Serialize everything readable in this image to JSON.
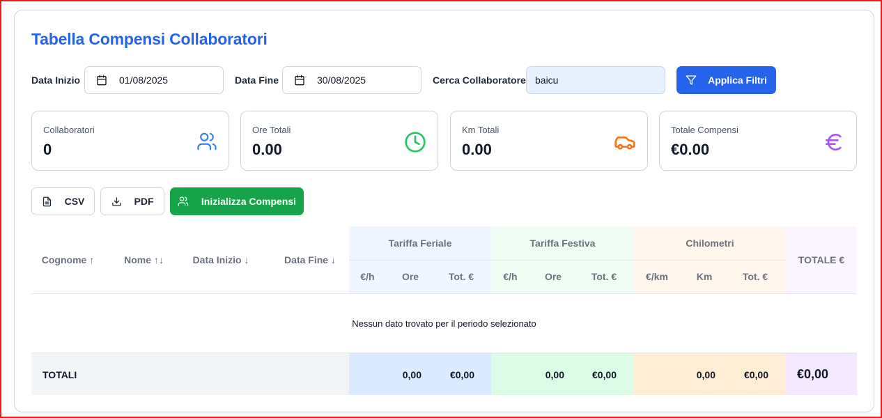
{
  "title": "Tabella Compensi Collaboratori",
  "filters": {
    "start_label": "Data Inizio",
    "start_value": "01/08/2025",
    "end_label": "Data Fine",
    "end_value": "30/08/2025",
    "search_label": "Cerca Collaboratore",
    "search_value": "baicu",
    "apply_label": "Applica Filtri"
  },
  "stats": [
    {
      "label": "Collaboratori",
      "value": "0",
      "icon": "users-icon",
      "color": "#3b82f6"
    },
    {
      "label": "Ore Totali",
      "value": "0.00",
      "icon": "clock-icon",
      "color": "#22c55e"
    },
    {
      "label": "Km Totali",
      "value": "0.00",
      "icon": "car-icon",
      "color": "#f97316"
    },
    {
      "label": "Totale Compensi",
      "value": "€0.00",
      "icon": "euro-icon",
      "color": "#a855f7"
    }
  ],
  "actions": {
    "csv": "CSV",
    "pdf": "PDF",
    "init": "Inizializza Compensi"
  },
  "table": {
    "columns": {
      "cognome": "Cognome ↑",
      "nome": "Nome ↑↓",
      "data_inizio": "Data Inizio ↓",
      "data_fine": "Data Fine ↓",
      "totale": "TOTALE €"
    },
    "groups": {
      "feriale": "Tariffa Feriale",
      "festiva": "Tariffa Festiva",
      "km": "Chilometri"
    },
    "sub": {
      "eur_h": "€/h",
      "ore": "Ore",
      "tot": "Tot. €",
      "eur_km": "€/km",
      "km": "Km"
    },
    "empty_message": "Nessun dato trovato per il periodo selezionato",
    "totals": {
      "label": "TOTALI",
      "feriale_ore": "0,00",
      "feriale_tot": "€0,00",
      "festiva_ore": "0,00",
      "festiva_tot": "€0,00",
      "km_km": "0,00",
      "km_tot": "€0,00",
      "grand_total": "€0,00"
    }
  },
  "colors": {
    "accent": "#2563eb",
    "green": "#16a34a",
    "feriale_bg": "#eff6ff",
    "festiva_bg": "#f0fdf4",
    "km_bg": "#fff7ed",
    "totale_bg": "#faf5ff"
  }
}
